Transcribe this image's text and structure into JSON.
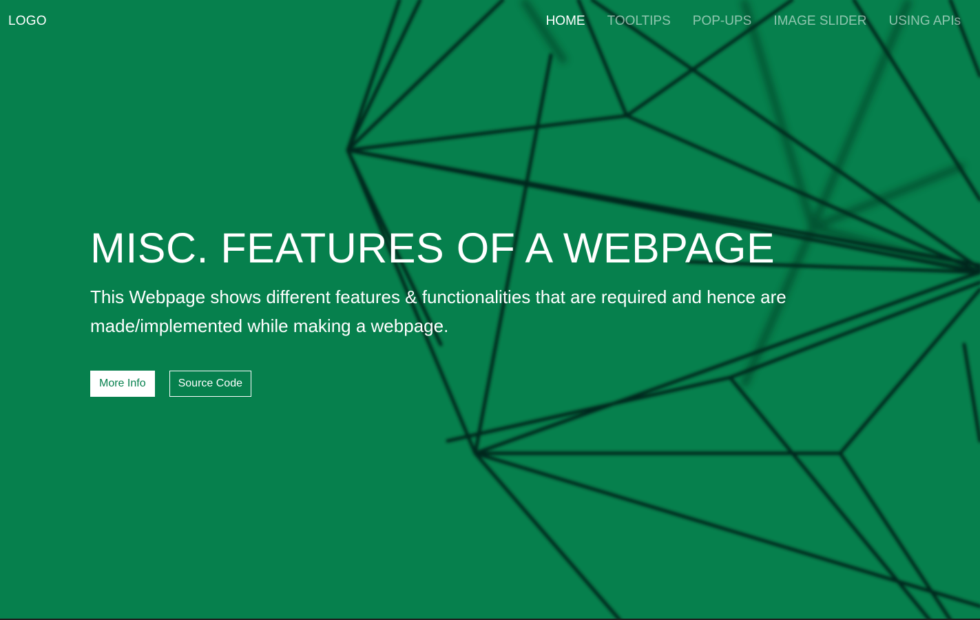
{
  "header": {
    "logo": "LOGO",
    "nav": [
      {
        "label": "HOME",
        "active": true
      },
      {
        "label": "TOOLTIPS",
        "active": false
      },
      {
        "label": "POP-UPS",
        "active": false
      },
      {
        "label": "IMAGE SLIDER",
        "active": false
      },
      {
        "label": "USING APIs",
        "active": false
      }
    ]
  },
  "hero": {
    "title": "MISC. FEATURES OF A WEBPAGE",
    "subtitle": "This Webpage shows different features & functionalities that are required and hence are made/implemented while making a webpage.",
    "buttons": {
      "more_info": "More Info",
      "source_code": "Source Code"
    }
  },
  "colors": {
    "background": "#06804d",
    "text": "#ffffff",
    "wireframe": "#06281a"
  }
}
